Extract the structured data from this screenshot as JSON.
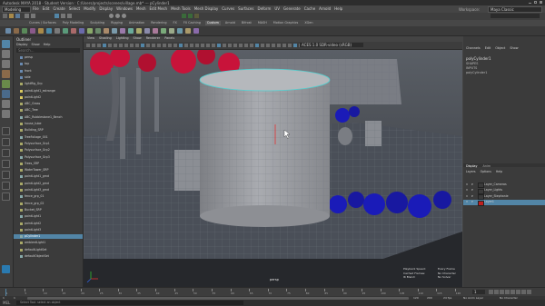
{
  "window": {
    "title": "Autodesk MAYA 2018 - Student Version : C:/Users/projects/scenes/village.mb* --- pCylinder1"
  },
  "menubar": {
    "workspace_menu": "Modeling",
    "items": [
      "File",
      "Edit",
      "Create",
      "Select",
      "Modify",
      "Display",
      "Windows",
      "Mesh",
      "Edit Mesh",
      "Mesh Tools",
      "Mesh Display",
      "Curves",
      "Surfaces",
      "Deform",
      "UV",
      "Generate",
      "Cache",
      "Arnold",
      "Help"
    ],
    "workspace_label": "Workspace:",
    "workspace_value": "Maya Classic"
  },
  "shelf": {
    "tabs": [
      "Curves / Surfaces",
      "Poly Modeling",
      "Sculpting",
      "Rigging",
      "Animation",
      "Rendering",
      "FX",
      "FX Caching",
      "Custom",
      "Arnold",
      "Bifrost",
      "MASH",
      "Motion Graphics",
      "XGen"
    ],
    "active_tab": "Custom"
  },
  "toolbox": {
    "tools": [
      "select-tool",
      "lasso-tool",
      "paint-select-tool",
      "move-tool",
      "rotate-tool",
      "scale-tool",
      "last-tool",
      "soft-select",
      "layout-single",
      "layout-four",
      "layout-side",
      "layout-outliner",
      "layout-graph",
      "layout-hypershade",
      "layout-script",
      "maya-logo"
    ]
  },
  "outliner": {
    "title": "Outliner",
    "menu": [
      "Display",
      "Show",
      "Help"
    ],
    "search_placeholder": "Search...",
    "items": [
      "persp",
      "top",
      "front",
      "side",
      "lightRig_Grp",
      "pointLight1_estrange",
      "pointLight2",
      "ABC_Grass",
      "ABC_Tree",
      "ABC_Rubblestone1_Bench",
      "house_tube",
      "Building_SRP",
      "TreeFoliage_001",
      "Polysurface_Grp1",
      "Polysurface_Grp2",
      "Polysurface_Grp3",
      "Trees_SRP",
      "WaterTower_SRP",
      "pointLight1_grnd",
      "pointLight2_grnd",
      "pointLight3_grnd",
      "fence_grp_01",
      "fence_grp_02",
      "Bucket_SRP",
      "pointLight1",
      "pointLight2",
      "pointLight3",
      "pCylinder1",
      "ambientLight1",
      "defaultLightSet",
      "defaultObjectSet"
    ],
    "selected_index": 27
  },
  "viewport": {
    "menu": [
      "View",
      "Shading",
      "Lighting",
      "Show",
      "Renderer",
      "Panels"
    ],
    "camera_label": "persp",
    "colorspace": "ACES 1.0 SDR-video (sRGB)",
    "hud": {
      "left": [
        "Playback Speed:",
        "Cached Frames:",
        "IK Blend:"
      ],
      "right": [
        "Every Frame",
        "No Character",
        "No Solver"
      ]
    }
  },
  "channel_box": {
    "tabs": [
      "Channels",
      "Edit",
      "Object",
      "Show"
    ],
    "object_name": "polyCylinder1",
    "sections": [
      "SHAPES",
      "INPUTS",
      "polyCylinder1"
    ],
    "layers": {
      "tabs": [
        "Display",
        "Anim"
      ],
      "menu": [
        "Layers",
        "Options",
        "Help"
      ],
      "rows": [
        {
          "label": "Layer_Cameras",
          "color": "#3a3a3a",
          "vis": "V",
          "playback": "P"
        },
        {
          "label": "Layer_Lights",
          "color": "#3a3a3a",
          "vis": "V",
          "playback": "P"
        },
        {
          "label": "Layer_Stephanie",
          "color": "#3a3a3a",
          "vis": "V",
          "playback": "P"
        },
        {
          "label": "Layer1",
          "color": "#c02020",
          "vis": "V",
          "playback": "P",
          "selected": true
        }
      ]
    }
  },
  "timeline": {
    "ticks": [
      "1",
      "5",
      "10",
      "15",
      "20",
      "25",
      "30",
      "35",
      "40",
      "45",
      "50",
      "55",
      "60",
      "65",
      "70",
      "75",
      "80",
      "85",
      "90",
      "95",
      "100",
      "105",
      "110",
      "115",
      "120"
    ],
    "current_frame": "1",
    "range_start": "1",
    "range_end": "120",
    "anim_start": "1",
    "anim_end": "200",
    "fps": "24 fps",
    "no_character": "No Character",
    "no_anim_layer": "No Anim Layer"
  },
  "command_line": {
    "lang": "MEL",
    "help_text": "Select Tool: select an object"
  },
  "colors": {
    "accent": "#5285a6",
    "selected_highlight": "#5285a6",
    "foliage_red": "#c8133a",
    "foliage_blue": "#1a1bb8"
  }
}
